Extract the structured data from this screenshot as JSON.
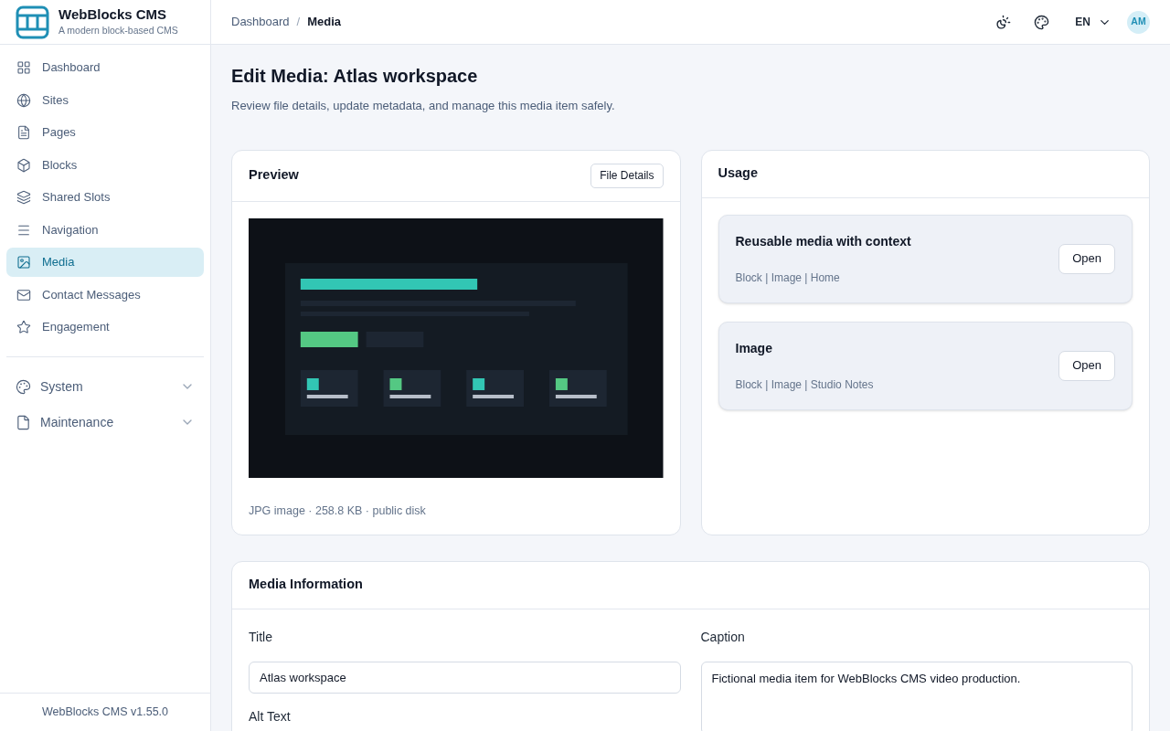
{
  "brand": {
    "name": "WebBlocks CMS",
    "tagline": "A modern block-based CMS"
  },
  "nav": [
    {
      "label": "Dashboard",
      "selected": false
    },
    {
      "label": "Sites",
      "selected": false
    },
    {
      "label": "Pages",
      "selected": false
    },
    {
      "label": "Blocks",
      "selected": false
    },
    {
      "label": "Shared Slots",
      "selected": false
    },
    {
      "label": "Navigation",
      "selected": false
    },
    {
      "label": "Media",
      "selected": true
    },
    {
      "label": "Contact Messages",
      "selected": false
    },
    {
      "label": "Engagement",
      "selected": false
    }
  ],
  "nav_groups": [
    {
      "label": "System",
      "expanded": false
    },
    {
      "label": "Maintenance",
      "expanded": false
    }
  ],
  "version": "WebBlocks CMS v1.55.0",
  "breadcrumb": {
    "items": [
      "Dashboard",
      "Media"
    ],
    "separator": "/"
  },
  "header": {
    "language": "EN",
    "avatar": "AM"
  },
  "page": {
    "title": "Edit Media: Atlas workspace",
    "subtitle": "Review file details, update metadata, and manage this media item safely."
  },
  "preview": {
    "title": "Preview",
    "button": "File Details",
    "meta": "JPG image · 258.8 KB · public disk"
  },
  "usage": {
    "title": "Usage",
    "items": [
      {
        "title": "Reusable media with context",
        "meta": "Block | Image | Home",
        "button": "Open"
      },
      {
        "title": "Image",
        "meta": "Block | Image | Studio Notes",
        "button": "Open"
      }
    ]
  },
  "media_info": {
    "title": "Media Information",
    "fields": [
      {
        "label": "Title",
        "value": "Atlas workspace",
        "kind": "input"
      },
      {
        "label": "Caption",
        "value": "Fictional media item for WebBlocks CMS video production.",
        "kind": "textarea"
      }
    ],
    "next_label": "Alt Text"
  }
}
